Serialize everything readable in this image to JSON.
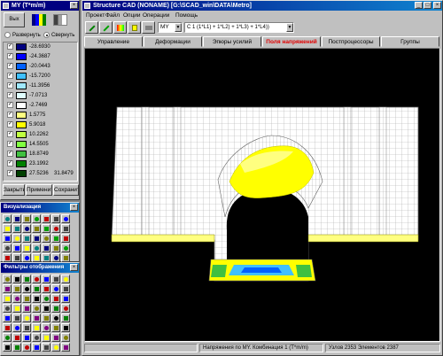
{
  "colors": {
    "desktop": "#808080",
    "canvas": "#000000",
    "mesh_fill": "#ffffff",
    "mesh_line": "#b0b0b0",
    "active_tab": "#e00000",
    "title_start": "#000080",
    "title_end": "#1084d0"
  },
  "legend_window": {
    "title": "MY  (T*m/m)",
    "mode_options": [
      "Развернуть",
      "Свернуть"
    ],
    "rows": [
      {
        "value": "-28.6930",
        "color": "#000080"
      },
      {
        "value": "-24.3687",
        "color": "#0000ff"
      },
      {
        "value": "-20.0443",
        "color": "#0060ff"
      },
      {
        "value": "-15.7200",
        "color": "#40c0ff"
      },
      {
        "value": "-11.3956",
        "color": "#a0e8ff"
      },
      {
        "value": "-7.0713",
        "color": "#e0ffff"
      },
      {
        "value": "-2.7469",
        "color": "#ffffff"
      },
      {
        "value": "1.5775",
        "color": "#ffff80"
      },
      {
        "value": "5.9018",
        "color": "#ffff00"
      },
      {
        "value": "10.2262",
        "color": "#c0ff40"
      },
      {
        "value": "14.5505",
        "color": "#80ff40"
      },
      {
        "value": "18.8749",
        "color": "#40c040"
      },
      {
        "value": "23.1992",
        "color": "#008000"
      },
      {
        "value": "27.5236",
        "value2": "31.8479",
        "color": "#004000"
      }
    ],
    "buttons": [
      "Закрыть",
      "Применить",
      "Сохранить"
    ]
  },
  "toolbar_windows": [
    {
      "title": "Визуализация"
    },
    {
      "title": "Фильтры отображения"
    }
  ],
  "main_window": {
    "title": "Structure CAD (NONAME)  [G:\\SCAD_win\\DATA\\Metro]",
    "menu": [
      "Проект",
      "Файл",
      "Опции",
      "Операции",
      "Помощь"
    ],
    "factor_select": "MY",
    "combination_select": "С 1 (1*L1) + 1*L2) + 1*L3) + 1*L4))",
    "tabs": [
      "Управление",
      "Деформации",
      "Эпюры усилий",
      "Поля напряжений",
      "Постпроцессоры",
      "Группы"
    ],
    "active_tab_index": 3,
    "status": {
      "left": "",
      "center": "Напряжения по MY. Комбинация 1 (T*m/m)",
      "right": "Узлов 2353 Элементов 2387"
    }
  }
}
